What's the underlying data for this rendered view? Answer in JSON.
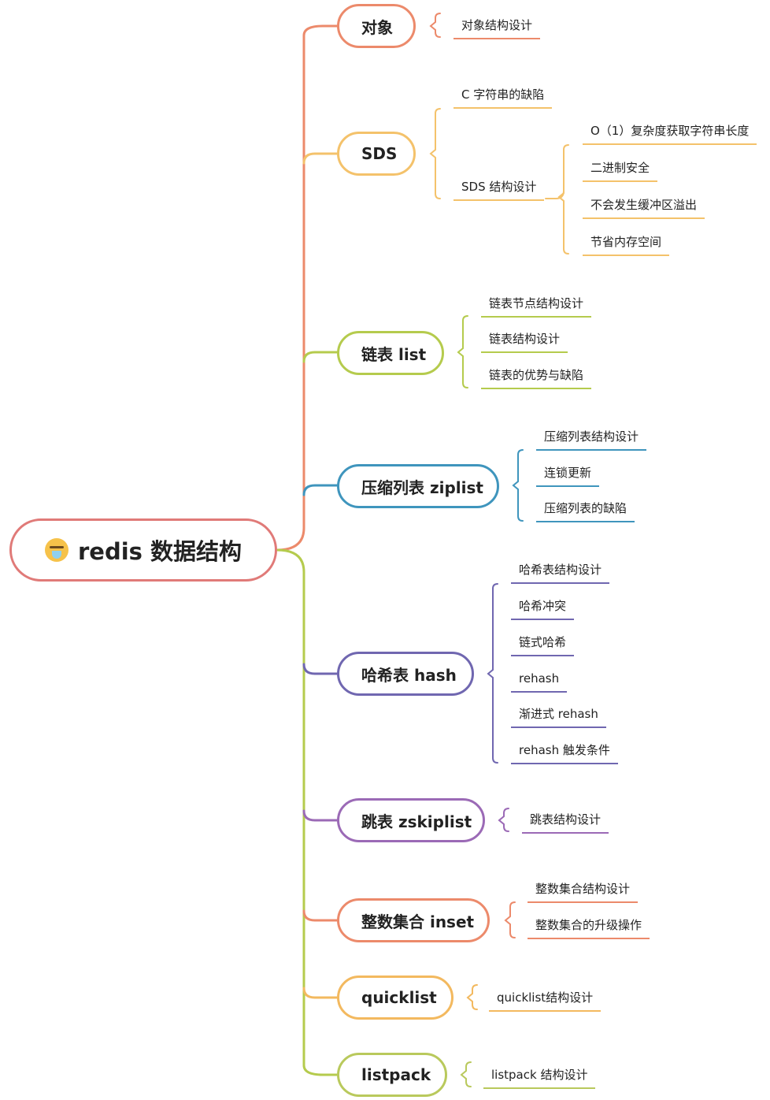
{
  "root": {
    "label": "redis 数据结构",
    "icon": "crying-face-emoji"
  },
  "colors": {
    "red": "#e07a78",
    "orange": "#f2a85f",
    "yellow": "#f4c26b",
    "lime": "#b5cb4d",
    "blue": "#3f95bd",
    "indigo": "#7067b0",
    "purple": "#9b6ab6",
    "coral": "#ec8a6b",
    "amber": "#f3b95f",
    "green": "#b9c95c"
  },
  "topics": [
    {
      "label": "对象",
      "children": [
        "对象结构设计"
      ]
    },
    {
      "label": "SDS",
      "children": [
        "C 字符串的缺陷",
        "SDS 结构设计"
      ],
      "grandchildren": [
        "O（1）复杂度获取字符串长度",
        "二进制安全",
        "不会发生缓冲区溢出",
        "节省内存空间"
      ]
    },
    {
      "label": "链表 list",
      "children": [
        "链表节点结构设计",
        "链表结构设计",
        "链表的优势与缺陷"
      ]
    },
    {
      "label": "压缩列表 ziplist",
      "children": [
        "压缩列表结构设计",
        "连锁更新",
        "压缩列表的缺陷"
      ]
    },
    {
      "label": "哈希表 hash",
      "children": [
        "哈希表结构设计",
        "哈希冲突",
        "链式哈希",
        "rehash",
        "渐进式 rehash",
        "rehash 触发条件"
      ]
    },
    {
      "label": "跳表 zskiplist",
      "children": [
        "跳表结构设计"
      ]
    },
    {
      "label": "整数集合 inset",
      "children": [
        "整数集合结构设计",
        "整数集合的升级操作"
      ]
    },
    {
      "label": "quicklist",
      "children": [
        "quicklist结构设计"
      ]
    },
    {
      "label": "listpack",
      "children": [
        "listpack 结构设计"
      ]
    }
  ]
}
